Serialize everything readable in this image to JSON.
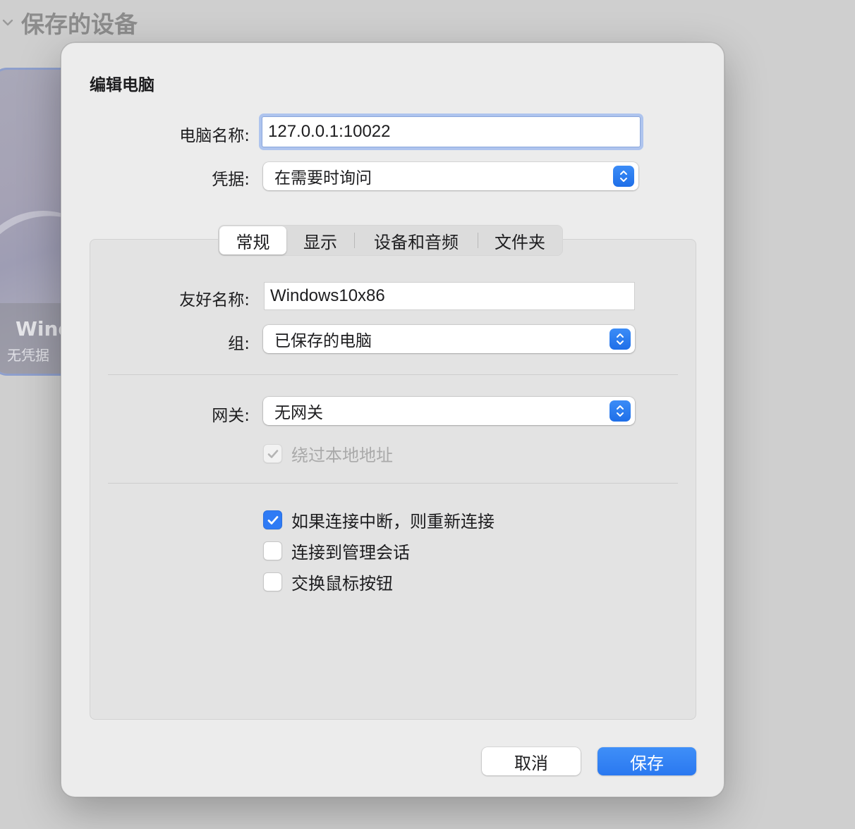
{
  "background": {
    "header_title": "保存的设备",
    "card": {
      "title": "Wind",
      "subtitle": "无凭据"
    }
  },
  "dialog": {
    "title": "编辑电脑",
    "computer_name": {
      "label": "电脑名称:",
      "value": "127.0.0.1:10022"
    },
    "credentials": {
      "label": "凭据:",
      "value": "在需要时询问"
    },
    "tabs": [
      {
        "label": "常规",
        "selected": true
      },
      {
        "label": "显示",
        "selected": false
      },
      {
        "label": "设备和音频",
        "selected": false
      },
      {
        "label": "文件夹",
        "selected": false
      }
    ],
    "general": {
      "friendly_name": {
        "label": "友好名称:",
        "value": "Windows10x86"
      },
      "group": {
        "label": "组:",
        "value": "已保存的电脑"
      },
      "gateway": {
        "label": "网关:",
        "value": "无网关"
      },
      "bypass_local": {
        "label": "绕过本地地址",
        "checked": true,
        "enabled": false
      },
      "reconnect": {
        "label": "如果连接中断，则重新连接",
        "checked": true
      },
      "admin_session": {
        "label": "连接到管理会话",
        "checked": false
      },
      "swap_mouse": {
        "label": "交换鼠标按钮",
        "checked": false
      }
    },
    "buttons": {
      "cancel": "取消",
      "save": "保存"
    }
  },
  "colors": {
    "accent": "#2f7bf5",
    "focus_ring": "#aec4ee"
  }
}
